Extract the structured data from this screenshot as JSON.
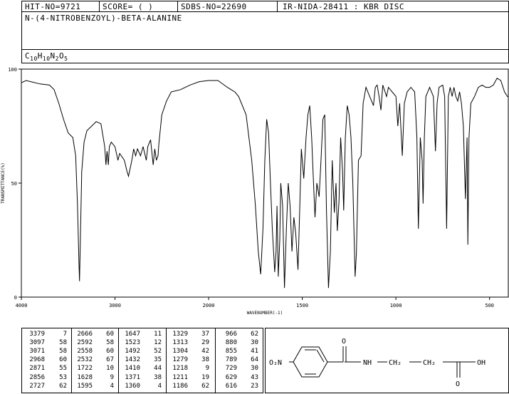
{
  "header": {
    "hit_no": "HIT-NO=9721",
    "score": "SCORE=  (   )",
    "sdbs_no": "SDBS-NO=22690",
    "method": "IR-NIDA-28411 : KBR DISC",
    "compound_name": "N-(4-NITROBENZOYL)-BETA-ALANINE",
    "formula": "C10H10N2O5"
  },
  "chart_data": {
    "type": "line",
    "xlabel": "WAVENUMBER(-1)",
    "ylabel": "TRANSMITTANCE(%)",
    "xlim": [
      4000,
      400
    ],
    "ylim": [
      0,
      100
    ],
    "x_ticks": [
      4000,
      3000,
      2000,
      1500,
      1000,
      500
    ],
    "y_ticks": [
      0,
      50,
      100
    ],
    "x_tick_labels": [
      "4000",
      "3000",
      "2000",
      "1500",
      "1000",
      "500"
    ],
    "y_tick_labels": [
      "0",
      "50",
      "100"
    ],
    "series": [
      {
        "points": [
          [
            4000,
            94
          ],
          [
            3950,
            95
          ],
          [
            3900,
            94.5
          ],
          [
            3800,
            93.5
          ],
          [
            3700,
            93
          ],
          [
            3650,
            91
          ],
          [
            3600,
            85
          ],
          [
            3550,
            78
          ],
          [
            3500,
            72
          ],
          [
            3450,
            70
          ],
          [
            3420,
            62
          ],
          [
            3400,
            40
          ],
          [
            3385,
            15
          ],
          [
            3379,
            7
          ],
          [
            3370,
            25
          ],
          [
            3355,
            55
          ],
          [
            3330,
            68
          ],
          [
            3300,
            73
          ],
          [
            3250,
            75
          ],
          [
            3200,
            77
          ],
          [
            3150,
            76
          ],
          [
            3110,
            66
          ],
          [
            3097,
            58
          ],
          [
            3085,
            64
          ],
          [
            3071,
            58
          ],
          [
            3060,
            66
          ],
          [
            3040,
            68
          ],
          [
            3000,
            66
          ],
          [
            2968,
            60
          ],
          [
            2950,
            63
          ],
          [
            2900,
            60
          ],
          [
            2871,
            55
          ],
          [
            2856,
            53
          ],
          [
            2820,
            60
          ],
          [
            2800,
            65
          ],
          [
            2780,
            62
          ],
          [
            2760,
            65
          ],
          [
            2727,
            62
          ],
          [
            2700,
            66
          ],
          [
            2666,
            60
          ],
          [
            2650,
            66
          ],
          [
            2620,
            69
          ],
          [
            2592,
            58
          ],
          [
            2575,
            65
          ],
          [
            2558,
            60
          ],
          [
            2540,
            62
          ],
          [
            2532,
            67
          ],
          [
            2500,
            80
          ],
          [
            2450,
            86
          ],
          [
            2400,
            90
          ],
          [
            2300,
            91
          ],
          [
            2200,
            93
          ],
          [
            2100,
            94.5
          ],
          [
            2000,
            95
          ],
          [
            1950,
            95
          ],
          [
            1900,
            92
          ],
          [
            1860,
            90
          ],
          [
            1840,
            88
          ],
          [
            1800,
            80
          ],
          [
            1770,
            60
          ],
          [
            1750,
            40
          ],
          [
            1735,
            20
          ],
          [
            1722,
            10
          ],
          [
            1710,
            30
          ],
          [
            1700,
            60
          ],
          [
            1690,
            78
          ],
          [
            1680,
            72
          ],
          [
            1670,
            50
          ],
          [
            1660,
            30
          ],
          [
            1647,
            11
          ],
          [
            1640,
            20
          ],
          [
            1635,
            40
          ],
          [
            1628,
            9
          ],
          [
            1620,
            25
          ],
          [
            1615,
            50
          ],
          [
            1605,
            40
          ],
          [
            1595,
            4
          ],
          [
            1585,
            30
          ],
          [
            1575,
            50
          ],
          [
            1565,
            40
          ],
          [
            1555,
            20
          ],
          [
            1545,
            35
          ],
          [
            1535,
            28
          ],
          [
            1523,
            12
          ],
          [
            1515,
            35
          ],
          [
            1505,
            65
          ],
          [
            1492,
            52
          ],
          [
            1480,
            70
          ],
          [
            1470,
            80
          ],
          [
            1460,
            84
          ],
          [
            1450,
            70
          ],
          [
            1440,
            50
          ],
          [
            1432,
            35
          ],
          [
            1422,
            50
          ],
          [
            1410,
            44
          ],
          [
            1400,
            60
          ],
          [
            1390,
            78
          ],
          [
            1380,
            80
          ],
          [
            1371,
            38
          ],
          [
            1360,
            4
          ],
          [
            1350,
            20
          ],
          [
            1340,
            60
          ],
          [
            1329,
            37
          ],
          [
            1320,
            50
          ],
          [
            1313,
            29
          ],
          [
            1304,
            42
          ],
          [
            1295,
            70
          ],
          [
            1285,
            55
          ],
          [
            1279,
            38
          ],
          [
            1270,
            70
          ],
          [
            1260,
            84
          ],
          [
            1250,
            80
          ],
          [
            1240,
            70
          ],
          [
            1230,
            50
          ],
          [
            1218,
            9
          ],
          [
            1211,
            19
          ],
          [
            1200,
            60
          ],
          [
            1186,
            62
          ],
          [
            1175,
            85
          ],
          [
            1160,
            92
          ],
          [
            1140,
            88
          ],
          [
            1120,
            84
          ],
          [
            1110,
            92
          ],
          [
            1100,
            93
          ],
          [
            1090,
            88
          ],
          [
            1080,
            82
          ],
          [
            1070,
            93
          ],
          [
            1050,
            88
          ],
          [
            1040,
            92
          ],
          [
            1020,
            90
          ],
          [
            1000,
            88
          ],
          [
            990,
            75
          ],
          [
            980,
            85
          ],
          [
            966,
            62
          ],
          [
            955,
            85
          ],
          [
            940,
            90
          ],
          [
            920,
            92
          ],
          [
            900,
            90
          ],
          [
            888,
            70
          ],
          [
            880,
            30
          ],
          [
            870,
            70
          ],
          [
            860,
            60
          ],
          [
            855,
            41
          ],
          [
            848,
            70
          ],
          [
            840,
            88
          ],
          [
            820,
            92
          ],
          [
            800,
            88
          ],
          [
            789,
            64
          ],
          [
            780,
            85
          ],
          [
            770,
            92
          ],
          [
            750,
            93
          ],
          [
            740,
            88
          ],
          [
            729,
            30
          ],
          [
            720,
            88
          ],
          [
            710,
            92
          ],
          [
            700,
            88
          ],
          [
            690,
            92
          ],
          [
            680,
            88
          ],
          [
            670,
            86
          ],
          [
            660,
            90
          ],
          [
            650,
            85
          ],
          [
            640,
            75
          ],
          [
            629,
            43
          ],
          [
            620,
            70
          ],
          [
            616,
            23
          ],
          [
            610,
            70
          ],
          [
            600,
            85
          ],
          [
            580,
            88
          ],
          [
            560,
            92
          ],
          [
            540,
            93
          ],
          [
            520,
            92
          ],
          [
            500,
            92
          ],
          [
            480,
            93
          ],
          [
            460,
            96
          ],
          [
            440,
            95
          ],
          [
            420,
            90
          ],
          [
            405,
            88
          ],
          [
            400,
            88
          ]
        ]
      }
    ]
  },
  "peak_table": {
    "rows": [
      [
        [
          "3379",
          "7"
        ],
        [
          "2666",
          "60"
        ],
        [
          "1647",
          "11"
        ],
        [
          "1329",
          "37"
        ],
        [
          "966",
          "62"
        ]
      ],
      [
        [
          "3097",
          "58"
        ],
        [
          "2592",
          "58"
        ],
        [
          "1523",
          "12"
        ],
        [
          "1313",
          "29"
        ],
        [
          "880",
          "30"
        ]
      ],
      [
        [
          "3071",
          "58"
        ],
        [
          "2558",
          "60"
        ],
        [
          "1492",
          "52"
        ],
        [
          "1304",
          "42"
        ],
        [
          "855",
          "41"
        ]
      ],
      [
        [
          "2968",
          "60"
        ],
        [
          "2532",
          "67"
        ],
        [
          "1432",
          "35"
        ],
        [
          "1279",
          "38"
        ],
        [
          "789",
          "64"
        ]
      ],
      [
        [
          "2871",
          "55"
        ],
        [
          "1722",
          "10"
        ],
        [
          "1410",
          "44"
        ],
        [
          "1218",
          "9"
        ],
        [
          "729",
          "30"
        ]
      ],
      [
        [
          "2856",
          "53"
        ],
        [
          "1628",
          "9"
        ],
        [
          "1371",
          "38"
        ],
        [
          "1211",
          "19"
        ],
        [
          "629",
          "43"
        ]
      ],
      [
        [
          "2727",
          "62"
        ],
        [
          "1595",
          "4"
        ],
        [
          "1360",
          "4"
        ],
        [
          "1186",
          "62"
        ],
        [
          "616",
          "23"
        ]
      ]
    ]
  },
  "structure": {
    "no2": "O₂N",
    "carbonyl_o": "O",
    "nh": "NH",
    "ch2_a": "CH₂",
    "ch2_b": "CH₂",
    "cooh_o": "O",
    "oh": "OH"
  }
}
